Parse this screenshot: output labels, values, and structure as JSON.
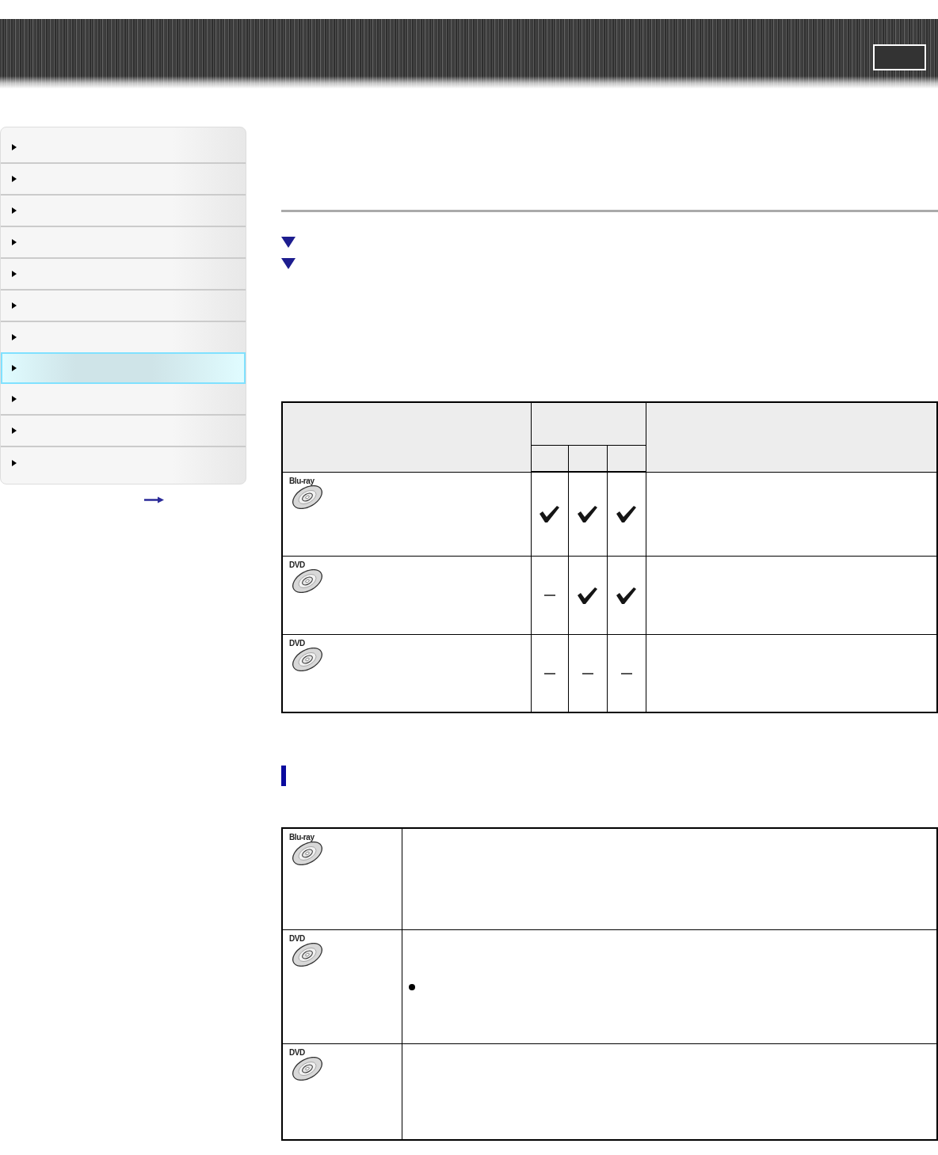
{
  "sidebar": {
    "items": [
      {
        "selected": false
      },
      {
        "selected": false
      },
      {
        "selected": false
      },
      {
        "selected": false
      },
      {
        "selected": false
      },
      {
        "selected": false
      },
      {
        "selected": false
      },
      {
        "selected": true
      },
      {
        "selected": false
      },
      {
        "selected": false
      },
      {
        "selected": false
      }
    ]
  },
  "compat_table": {
    "rows": [
      {
        "disc_label": "Blu-ray",
        "marks": [
          {
            "checked": true
          },
          {
            "checked": true
          },
          {
            "checked": true
          }
        ]
      },
      {
        "disc_label": "DVD",
        "marks": [
          {
            "checked": false
          },
          {
            "checked": true
          },
          {
            "checked": true
          }
        ]
      },
      {
        "disc_label": "DVD",
        "marks": [
          {
            "checked": false
          },
          {
            "checked": false
          },
          {
            "checked": false
          }
        ]
      }
    ]
  },
  "disc_table": {
    "rows": [
      {
        "disc_label": "Blu-ray",
        "bullet": false
      },
      {
        "disc_label": "DVD",
        "bullet": true
      },
      {
        "disc_label": "DVD",
        "bullet": false
      }
    ]
  }
}
